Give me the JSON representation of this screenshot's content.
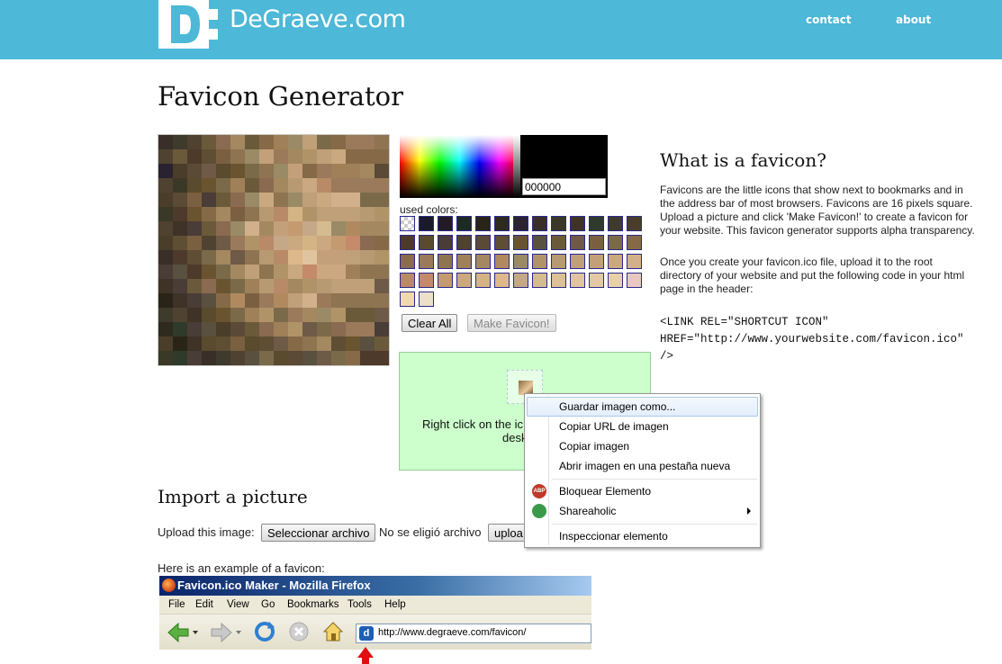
{
  "header": {
    "brand": "DeGraeve.com",
    "logo_letter": "D",
    "nav": [
      "contact",
      "about"
    ],
    "bg_color": "#4db8d7"
  },
  "page_title": "Favicon Generator",
  "picker": {
    "hex_value": "000000",
    "used_colors_label": "used colors:",
    "clear_button": "Clear All",
    "make_button": "Make Favicon!",
    "used_colors": [
      "checker",
      "#1a1a2a",
      "#221a26",
      "#1c2a22",
      "#2a2418",
      "#2f2a1e",
      "#2a2230",
      "#3a2f28",
      "#3a3826",
      "#3e3326",
      "#2f3a2a",
      "#3e3a2c",
      "#4a3e2a",
      "#4d3a2a",
      "#5a4a2e",
      "#4a3c36",
      "#4f4230",
      "#5a4a36",
      "#5e4e34",
      "#6a5430",
      "#5a5040",
      "#6a5a3a",
      "#6e5a46",
      "#7a6040",
      "#7a6a4a",
      "#866a48",
      "#8a6a50",
      "#9a7a5a",
      "#8e7450",
      "#a08058",
      "#a48860",
      "#b08a5e",
      "#9a8a66",
      "#b09468",
      "#b89a72",
      "#c0a078",
      "#c4a07a",
      "#caa880",
      "#d2b08c",
      "#b88a68",
      "#c48a6a",
      "#c49a70",
      "#cca880",
      "#d4b484",
      "#dcb88a",
      "#c4a888",
      "#d4bc90",
      "#dcc098",
      "#e0c4a0",
      "#e4c8a6",
      "#e8d0aa",
      "#e8c8c0",
      "#f0d8b0",
      "#ece0c8"
    ]
  },
  "result": {
    "line1": "Right click on the ic",
    "line2": "desk"
  },
  "right": {
    "heading": "What is a favicon?",
    "p1_lines": [
      "Favicons are the little icons that show next to bookmarks and in",
      "the address bar of most browsers. Favicons are 16 pixels square.",
      "Upload a picture and click 'Make Favicon!' to create a favicon for",
      "your website. This favicon generator supports alpha transparency."
    ],
    "p2_lines": [
      "Once you create your favicon.ico file, upload it to the root",
      "directory of your website and put the following code in your html",
      "page in the header:"
    ],
    "code_lines": [
      "<LINK REL=\"SHORTCUT ICON\"",
      "HREF=\"http://www.yourwebsite.com/favicon.ico\"",
      "/>"
    ]
  },
  "import": {
    "heading": "Import a picture",
    "upload_label": "Upload this image:",
    "choose_button": "Seleccionar archivo",
    "no_file": "No se eligió archivo",
    "upload_button": "uploa",
    "example_label": "Here is an example of a favicon:"
  },
  "browser_example": {
    "title": "Favicon.ico Maker - Mozilla Firefox",
    "menu": [
      "File",
      "Edit",
      "View",
      "Go",
      "Bookmarks",
      "Tools",
      "Help"
    ],
    "address": "http://www.degraeve.com/favicon/"
  },
  "context_menu": {
    "items": [
      {
        "label": "Guardar imagen como...",
        "hover": true
      },
      {
        "label": "Copiar URL de imagen"
      },
      {
        "label": "Copiar imagen"
      },
      {
        "label": "Abrir imagen en una pestaña nueva"
      },
      {
        "label": "Bloquear Elemento",
        "icon": "adblock-icon"
      },
      {
        "label": "Shareaholic",
        "icon": "shareaholic-icon",
        "submenu": true
      },
      {
        "label": "Inspeccionar elemento"
      }
    ]
  }
}
